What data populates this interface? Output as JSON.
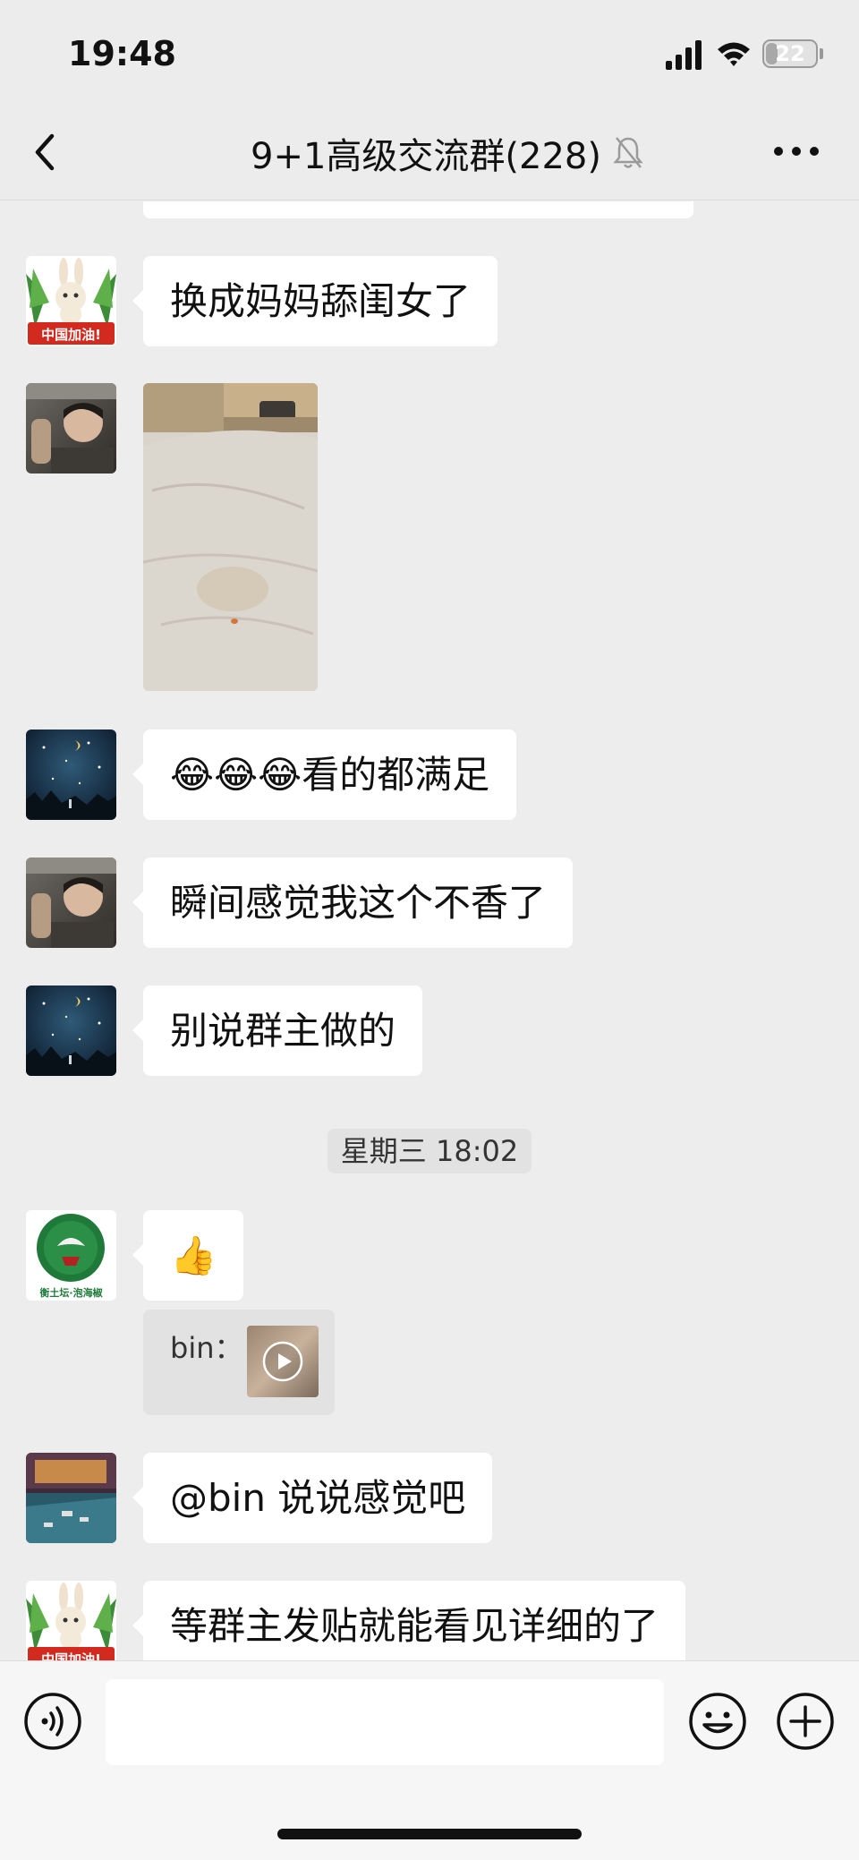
{
  "status_bar": {
    "time": "19:48",
    "battery": "22",
    "battery_fraction": 0.22
  },
  "header": {
    "title": "9+1高级交流群(228)"
  },
  "messages": {
    "m1": "换成妈妈舔闺女了",
    "m3_emojis": "😂😂😂",
    "m3_text": "看的都满足",
    "m4": "瞬间感觉我这个不香了",
    "m5": "别说群主做的",
    "timestamp": "星期三 18:02",
    "m6_emoji": "👍",
    "quote_name": "bin：",
    "m7": "@bin 说说感觉吧",
    "m8": "等群主发贴就能看见详细的了"
  },
  "avatars": {
    "rabbit_badge": "中国加油!",
    "forum_logo_text": "衡土坛·泡海椒"
  }
}
